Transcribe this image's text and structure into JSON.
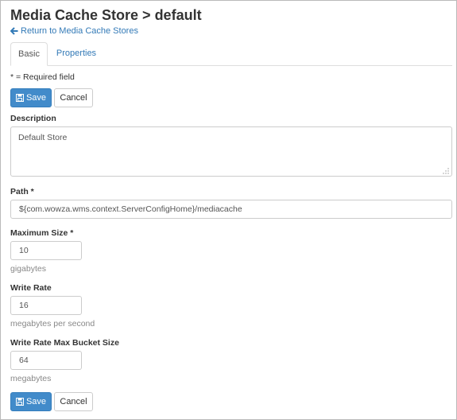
{
  "header": {
    "title": "Media Cache Store > default",
    "back_link": "Return to Media Cache Stores"
  },
  "tabs": [
    {
      "label": "Basic",
      "active": true
    },
    {
      "label": "Properties",
      "active": false
    }
  ],
  "required_note": "* = Required field",
  "buttons": {
    "save": "Save",
    "cancel": "Cancel"
  },
  "form": {
    "description": {
      "label": "Description",
      "value": "Default Store"
    },
    "path": {
      "label": "Path *",
      "value": "${com.wowza.wms.context.ServerConfigHome}/mediacache"
    },
    "max_size": {
      "label": "Maximum Size *",
      "value": "10",
      "unit": "gigabytes"
    },
    "write_rate": {
      "label": "Write Rate",
      "value": "16",
      "unit": "megabytes per second"
    },
    "bucket_size": {
      "label": "Write Rate Max Bucket Size",
      "value": "64",
      "unit": "megabytes"
    }
  },
  "colors": {
    "link": "#337ab7",
    "primary_button": "#428bca",
    "border": "#cccccc"
  },
  "icons": {
    "back": "arrow-left-icon",
    "save": "floppy-disk-icon",
    "resize": "resize-grip-icon"
  }
}
